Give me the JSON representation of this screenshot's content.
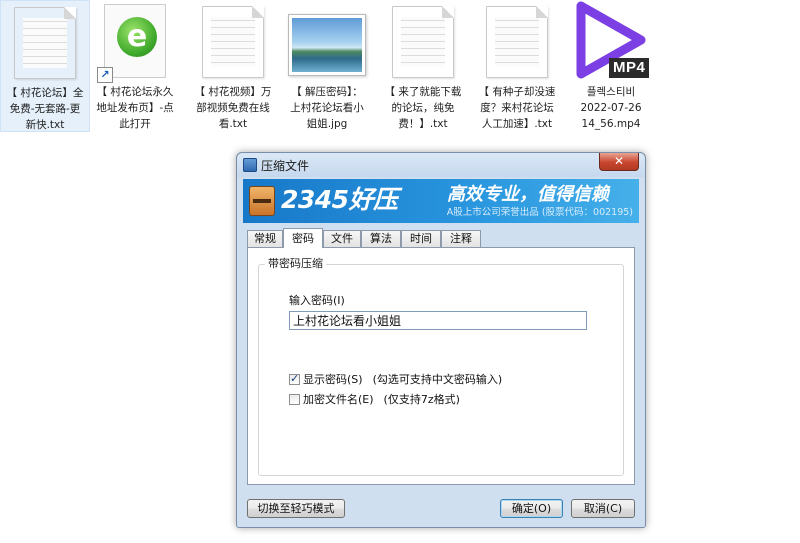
{
  "desktop": {
    "icons": [
      {
        "label": "【 村花论坛】全\n免费-无套路-更\n新快.txt",
        "type": "txt"
      },
      {
        "label": "【 村花论坛永久\n地址发布页】-点\n此打开",
        "type": "url-shortcut"
      },
      {
        "label": "【 村花视频】万\n部视频免费在线\n看.txt",
        "type": "txt"
      },
      {
        "label": "【 解压密码】：\n上村花论坛看小\n姐姐.jpg",
        "type": "jpg"
      },
      {
        "label": "【 来了就能下载\n的论坛，纯免\n费！】.txt",
        "type": "txt"
      },
      {
        "label": "【 有种子却没速\n度？来村花论坛\n人工加速】.txt",
        "type": "txt"
      },
      {
        "label": "플렉스티비\n2022-07-26\n14_56.mp4",
        "type": "mp4"
      }
    ],
    "mp4_badge": "MP4"
  },
  "dialog": {
    "title": "压缩文件",
    "close_glyph": "✕",
    "banner": {
      "brand": "2345好压",
      "slogan": "高效专业，值得信赖",
      "sub": "A股上市公司荣誉出品 (股票代码：002195)"
    },
    "tabs": [
      "常规",
      "密码",
      "文件",
      "算法",
      "时间",
      "注释"
    ],
    "active_tab": "密码",
    "group_title": "带密码压缩",
    "password_label": "输入密码(I)",
    "password_value": "上村花论坛看小姐姐",
    "show_password": {
      "label": "显示密码(S)",
      "hint": "(勾选可支持中文密码输入)",
      "checked": true
    },
    "encrypt_names": {
      "label": "加密文件名(E)",
      "hint": "(仅支持7z格式)",
      "checked": false
    },
    "buttons": {
      "switch_mode": "切换至轻巧模式",
      "ok": "确定(O)",
      "cancel": "取消(C)"
    }
  }
}
